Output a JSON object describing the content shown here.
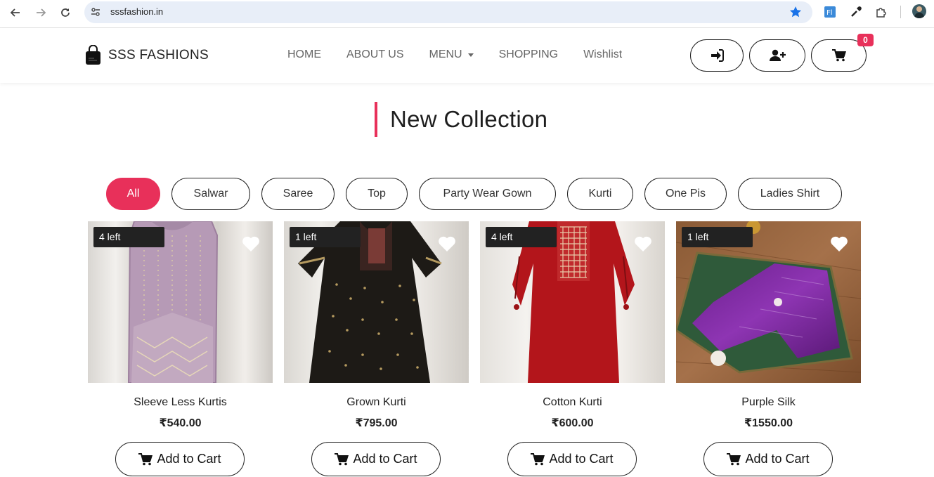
{
  "browser": {
    "url": "sssfashion.in"
  },
  "header": {
    "brand": "SSS FASHIONS",
    "menu": [
      {
        "label": "HOME"
      },
      {
        "label": "ABOUT US"
      },
      {
        "label": "MENU"
      },
      {
        "label": "SHOPPING"
      },
      {
        "label": "Wishlist"
      }
    ],
    "cart_count": "0",
    "icons": {
      "login": "sign-in-icon",
      "register": "user-plus-icon",
      "cart": "shopping-cart-icon"
    }
  },
  "section": {
    "title": "New Collection"
  },
  "filters": [
    {
      "label": "All",
      "active": true
    },
    {
      "label": "Salwar",
      "active": false
    },
    {
      "label": "Saree",
      "active": false
    },
    {
      "label": "Top",
      "active": false
    },
    {
      "label": "Party Wear Gown",
      "active": false
    },
    {
      "label": "Kurti",
      "active": false
    },
    {
      "label": "One Pis",
      "active": false
    },
    {
      "label": "Ladies Shirt",
      "active": false
    }
  ],
  "products": [
    {
      "name": "Sleeve Less Kurtis",
      "price": "₹540.00",
      "stock": "4 left",
      "add_label": "Add to Cart"
    },
    {
      "name": "Grown Kurti",
      "price": "₹795.00",
      "stock": "1 left",
      "add_label": "Add to Cart"
    },
    {
      "name": "Cotton Kurti",
      "price": "₹600.00",
      "stock": "4 left",
      "add_label": "Add to Cart"
    },
    {
      "name": "Purple Silk",
      "price": "₹1550.00",
      "stock": "1 left",
      "add_label": "Add to Cart"
    }
  ],
  "colors": {
    "accent": "#e8305a",
    "dark": "#222222",
    "star": "#1a73e8"
  }
}
